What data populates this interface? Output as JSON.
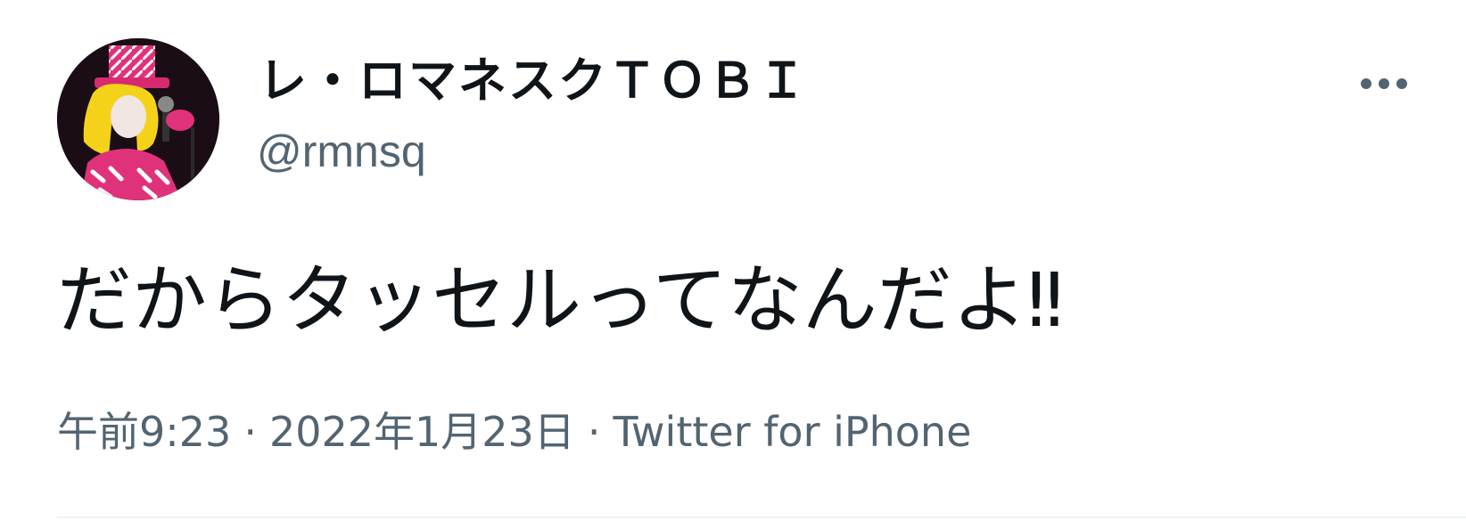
{
  "author": {
    "display_name": "レ・ロマネスクＴＯＢＩ",
    "handle": "@rmnsq",
    "avatar_icon": "profile-photo-performer-pink-hat-yellow-wig"
  },
  "more_icon": "more-horizontal-icon",
  "tweet": {
    "text": "だからタッセルってなんだよ‼",
    "time": "午前9:23",
    "date": "2022年1月23日",
    "source": "Twitter for iPhone",
    "separator": "·"
  },
  "colors": {
    "text_primary": "#0f1419",
    "text_secondary": "#536471",
    "divider": "#eff3f4",
    "avatar_accent_pink": "#e0327a",
    "avatar_accent_yellow": "#f5d21a"
  }
}
